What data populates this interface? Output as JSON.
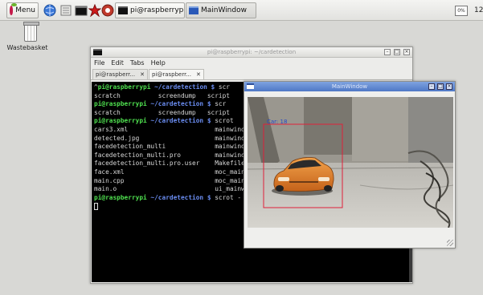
{
  "taskbar": {
    "menu_label": "Menu",
    "tasks": [
      {
        "label": "pi@raspberrypi: ~/ca..."
      },
      {
        "label": "MainWindow"
      }
    ],
    "cpu_usage": "0%",
    "clock": "12"
  },
  "desktop": {
    "trash_label": "Wastebasket"
  },
  "terminal": {
    "title": "pi@raspberrypi: ~/cardetection",
    "menu": [
      "File",
      "Edit",
      "Tabs",
      "Help"
    ],
    "tabs": [
      {
        "label": "pi@raspberr...",
        "close": "✕"
      },
      {
        "label": "pi@raspberr...",
        "close": "✕"
      }
    ],
    "prompt_user": "pi@raspberrypi",
    "prompt_dir": " ~/cardetection $ ",
    "lines": [
      {
        "type": "prompt",
        "lead": "^",
        "cmd": "scr"
      },
      {
        "type": "out",
        "text": "scratch          screendump   script"
      },
      {
        "type": "prompt",
        "lead": "",
        "cmd": "scr"
      },
      {
        "type": "out",
        "text": "scratch          screendump   script"
      },
      {
        "type": "prompt",
        "lead": "",
        "cmd": "scrot"
      },
      {
        "type": "out",
        "text": "cars3.xml                       mainwindo"
      },
      {
        "type": "out",
        "text": "detected.jpg                    mainwindo"
      },
      {
        "type": "out",
        "text": "facedetection_multi             mainwindo"
      },
      {
        "type": "out",
        "text": "facedetection_multi.pro         mainwindo"
      },
      {
        "type": "out",
        "text": "facedetection_multi.pro.user    Makefile"
      },
      {
        "type": "out",
        "text": "face.xml                        moc_mainw"
      },
      {
        "type": "out",
        "text": "main.cpp                        moc_mainw"
      },
      {
        "type": "out",
        "text": "main.o                          ui_mainwi"
      },
      {
        "type": "prompt",
        "lead": "",
        "cmd": "scrot -"
      },
      {
        "type": "cursor"
      }
    ]
  },
  "mainwindow": {
    "title": "MainWindow",
    "detection_label": "Car: 18"
  },
  "colors": {
    "prompt_user": "#4fe04f",
    "prompt_dir": "#6a8cf0",
    "detection_box": "#e0203a"
  }
}
